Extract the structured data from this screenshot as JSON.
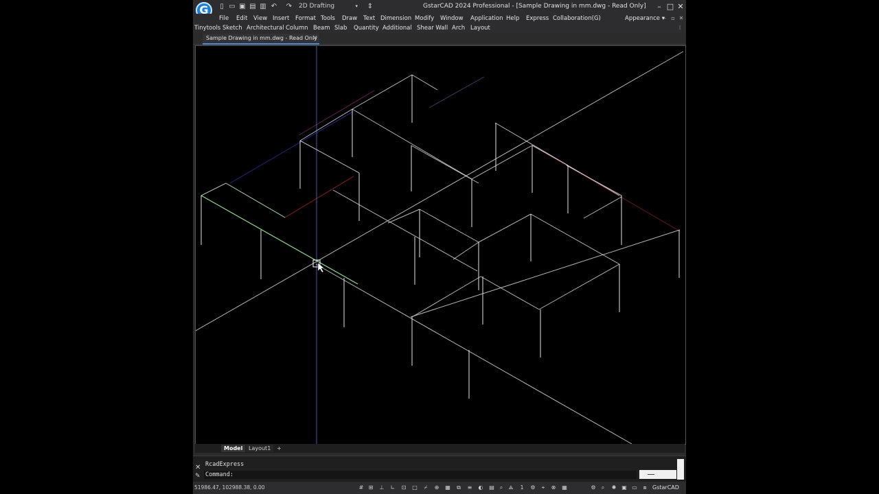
{
  "app": {
    "logo_letter": "G",
    "title": "GstarCAD 2024 Professional - [Sample Drawing in mm.dwg - Read Only]",
    "workspace": "2D Drafting"
  },
  "quick_access": [
    {
      "name": "new-file-icon",
      "glyph": "▯"
    },
    {
      "name": "open-folder-icon",
      "glyph": "▭"
    },
    {
      "name": "save-icon",
      "glyph": "▣"
    },
    {
      "name": "save-as-icon",
      "glyph": "▤"
    },
    {
      "name": "print-icon",
      "glyph": "▥"
    },
    {
      "name": "undo-icon",
      "glyph": "↶"
    },
    {
      "name": "redo-icon",
      "glyph": "↷"
    }
  ],
  "menubar": [
    "File",
    "Edit",
    "View",
    "Insert",
    "Format",
    "Tools",
    "Draw",
    "Text",
    "Dimension",
    "Modify",
    "Window",
    "Help",
    "Express",
    "Application",
    "Collaboration(G)"
  ],
  "appearance_label": "Appearance",
  "toolmenubar": [
    "Tinytools",
    "Sketch",
    "Architectural",
    "Column",
    "Beam",
    "Slab",
    "Quantity",
    "Additional",
    "Shear Wall",
    "Arch",
    "Layout"
  ],
  "document_tab": "Sample Drawing in mm.dwg - Read Only",
  "layout_tabs": {
    "model": "Model",
    "layout1": "Layout1",
    "add": "+"
  },
  "command": {
    "history": "RcadExpress",
    "prompt": "Command:"
  },
  "status": {
    "coordinates": "51986.47, 102988.38, 0.00",
    "product": "GstarCAD"
  },
  "colors": {
    "viewport_bg": "#000000",
    "beam_line": "#d8d8d8",
    "selected_edge": "#8fdc8f",
    "red_axis": "#b02a2a",
    "blue_axis": "#2a3db0",
    "accent": "#1e7fd6"
  }
}
